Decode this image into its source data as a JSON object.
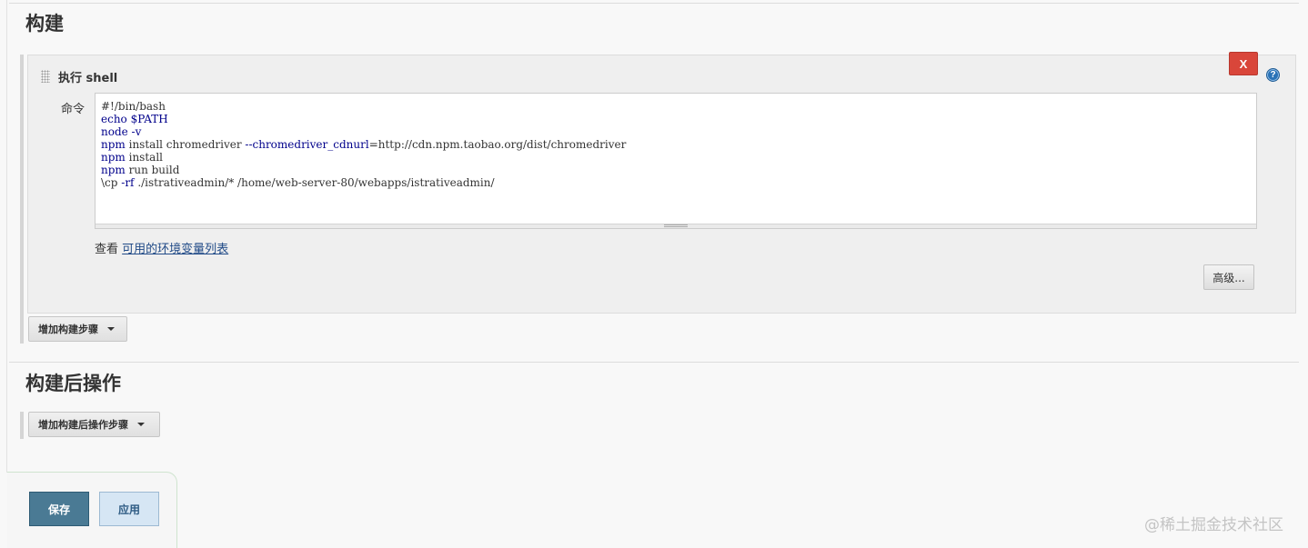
{
  "build": {
    "section_title": "构建",
    "step": {
      "title": "执行 shell",
      "delete_label": "X",
      "help_label": "?",
      "command_label": "命令",
      "command_lines": [
        {
          "kw": "",
          "rest": "#!/bin/bash"
        },
        {
          "kw": "echo $PATH",
          "rest": ""
        },
        {
          "kw": "node -v",
          "rest": ""
        },
        {
          "kw": "npm",
          "rest": " install chromedriver ",
          "flag": "--chromedriver_cdnurl",
          "tail": "=http://cdn.npm.taobao.org/dist/chromedriver"
        },
        {
          "kw": "npm",
          "rest": " install"
        },
        {
          "kw": "npm",
          "rest": " run build"
        },
        {
          "kw": "",
          "rest": "\\cp ",
          "flag": "-rf",
          "tail": " ./istrativeadmin/* /home/web-server-80/webapps/istrativeadmin/"
        }
      ],
      "env_prefix": "查看 ",
      "env_link": "可用的环境变量列表",
      "advanced_label": "高级..."
    },
    "add_step_label": "增加构建步骤"
  },
  "post_build": {
    "section_title": "构建后操作",
    "add_step_label": "增加构建后操作步骤"
  },
  "footer": {
    "save_label": "保存",
    "apply_label": "应用"
  },
  "watermark": "@稀土掘金技术社区"
}
